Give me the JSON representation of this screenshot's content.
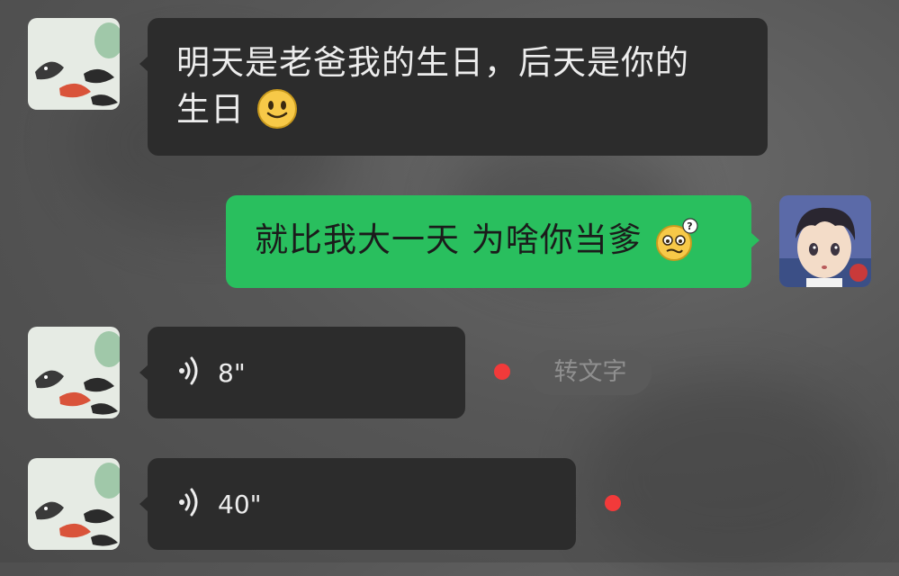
{
  "messages": [
    {
      "sender": "other",
      "type": "text",
      "line1": "明天是老爸我的生日，后天是你的",
      "line2": "生日",
      "emoji": "smile-emoji"
    },
    {
      "sender": "self",
      "type": "text",
      "text": "就比我大一天 为啥你当爹",
      "emoji": "confused-emoji"
    },
    {
      "sender": "other",
      "type": "voice",
      "duration": "8\"",
      "unread": true,
      "action_label": "转文字"
    },
    {
      "sender": "other",
      "type": "voice",
      "duration": "40\"",
      "unread": true
    }
  ],
  "colors": {
    "dark_bubble": "#2c2c2c",
    "green_bubble": "#29bf5e",
    "unread_dot": "#f23a3a"
  },
  "icons": [
    "koi-avatar",
    "boy-avatar",
    "voice-wave-icon"
  ]
}
